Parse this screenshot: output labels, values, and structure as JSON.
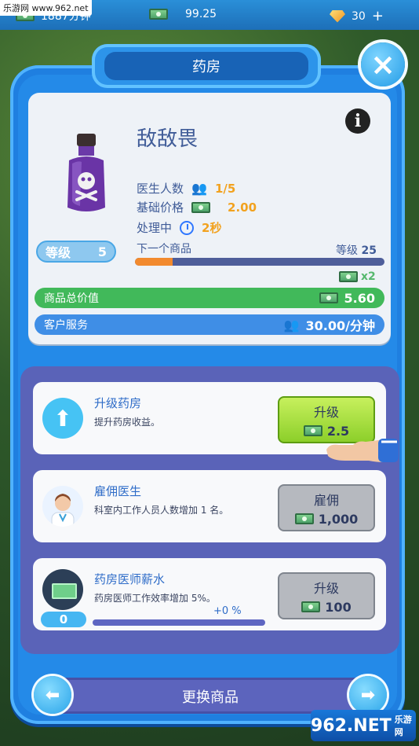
{
  "watermark": "乐游网 www.962.net",
  "topbar": {
    "left_value": "1887分钟",
    "cash_value": "99.25",
    "gems_value": "30",
    "gems_plus": "+"
  },
  "panel": {
    "title": "药房",
    "close_symbol": "×"
  },
  "item": {
    "name": "敌敌畏",
    "info_symbol": "i",
    "stats": {
      "doctors_label": "医生人数",
      "doctors_value": "1/5",
      "price_label": "基础价格",
      "price_value": "2.00",
      "processing_label": "处理中",
      "processing_value": "2秒"
    },
    "level_label": "等级",
    "level_value": "5",
    "next_item_label": "下一个商品",
    "next_level_label": "等级",
    "next_level_value": "25",
    "progress_fraction": 0.15,
    "multiplier": "x2",
    "total_value_label": "商品总价值",
    "total_value": "5.60",
    "service_label": "客户服务",
    "service_value": "30.00/分钟"
  },
  "upgrades": [
    {
      "title": "升级药房",
      "desc": "提升药房收益。",
      "button_label": "升级",
      "cost": "2.5"
    },
    {
      "title": "雇佣医生",
      "desc": "科室内工作人员人数增加 1 名。",
      "button_label": "雇佣",
      "cost": "1,000"
    },
    {
      "title": "药房医师薪水",
      "desc": "药房医师工作效率增加 5%。",
      "button_label": "升级",
      "cost": "100",
      "level": "0",
      "pct": "+0 %"
    }
  ],
  "bottom": {
    "label": "更换商品",
    "left_arrow": "⬅",
    "right_arrow": "➡"
  },
  "brand": {
    "main": "962.NET",
    "sub": "乐游网"
  }
}
